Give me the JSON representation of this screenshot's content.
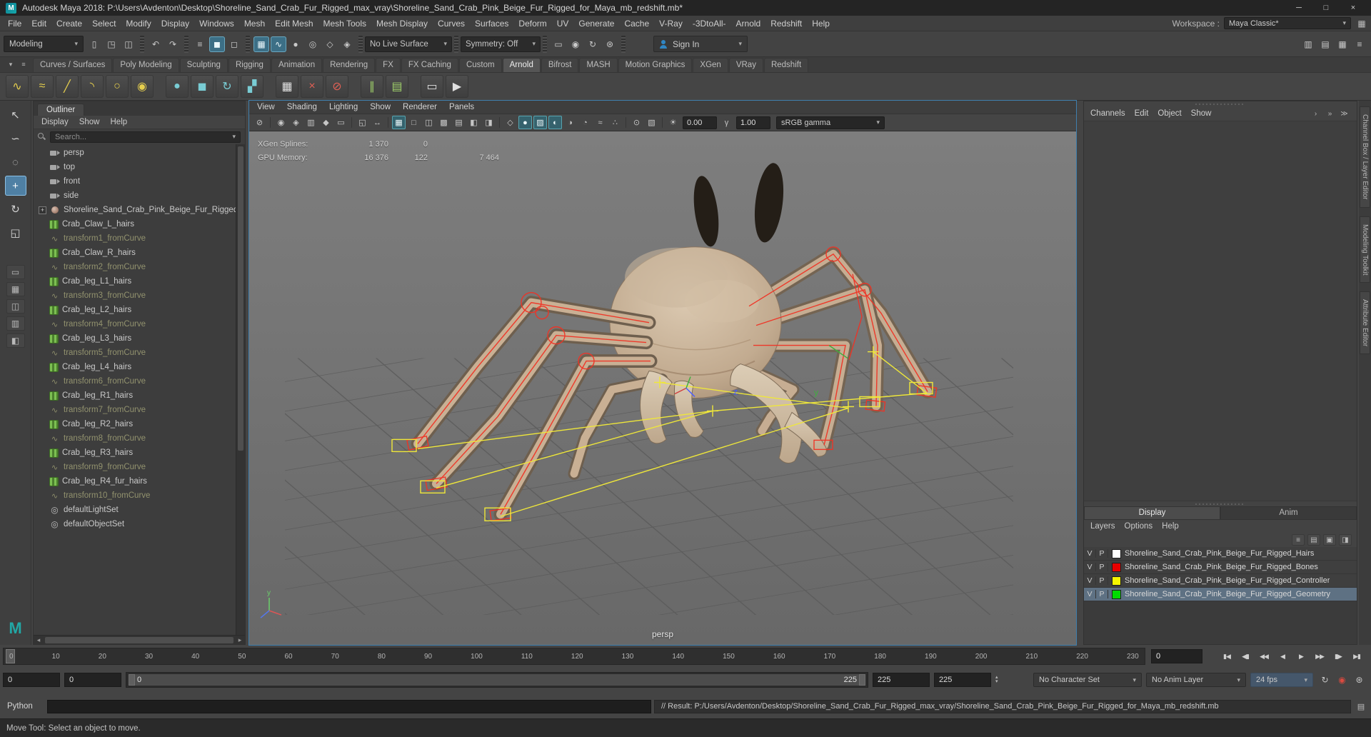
{
  "ui": {
    "caret": "▾",
    "caret_up": "▴",
    "caret_left": "◂",
    "caret_right": "▸",
    "plus": "+"
  },
  "titlebar": {
    "icon": "M",
    "title": "Autodesk Maya 2018: P:\\Users\\Avdenton\\Desktop\\Shoreline_Sand_Crab_Fur_Rigged_max_vray\\Shoreline_Sand_Crab_Pink_Beige_Fur_Rigged_for_Maya_mb_redshift.mb*",
    "buttons": [
      {
        "name": "minimize-button",
        "glyph": "─"
      },
      {
        "name": "maximize-button",
        "glyph": "□"
      },
      {
        "name": "close-button",
        "glyph": "×"
      }
    ]
  },
  "menubar": {
    "items": [
      "File",
      "Edit",
      "Create",
      "Select",
      "Modify",
      "Display",
      "Windows",
      "Mesh",
      "Edit Mesh",
      "Mesh Tools",
      "Mesh Display",
      "Curves",
      "Surfaces",
      "Deform",
      "UV",
      "Generate",
      "Cache",
      "V-Ray",
      "-3DtoAll-",
      "Arnold",
      "Redshift",
      "Help"
    ],
    "workspace_label": "Workspace :",
    "workspace_value": "Maya Classic*",
    "workspace_icon": "▦"
  },
  "statusline": {
    "mode": "Modeling",
    "icons_a": [
      {
        "name": "new-scene-icon",
        "glyph": "▯"
      },
      {
        "name": "open-scene-icon",
        "glyph": "◳"
      },
      {
        "name": "save-scene-icon",
        "glyph": "◫"
      },
      {
        "name": "separator",
        "glyph": "",
        "cls": "sep"
      },
      {
        "name": "undo-icon",
        "glyph": "↶"
      },
      {
        "name": "redo-icon",
        "glyph": "↷"
      },
      {
        "name": "separator",
        "glyph": "",
        "cls": "sep"
      },
      {
        "name": "select-hierarchy-icon",
        "glyph": "≡"
      },
      {
        "name": "select-object-icon",
        "glyph": "◼",
        "cls": "active"
      },
      {
        "name": "select-component-icon",
        "glyph": "◻"
      },
      {
        "name": "separator",
        "glyph": "",
        "cls": "sep"
      },
      {
        "name": "snap-grid-icon",
        "glyph": "▦",
        "cls": "active"
      },
      {
        "name": "snap-curve-icon",
        "glyph": "∿",
        "cls": "active"
      },
      {
        "name": "snap-point-icon",
        "glyph": "●"
      },
      {
        "name": "snap-projected-center-icon",
        "glyph": "◎"
      },
      {
        "name": "snap-view-plane-icon",
        "glyph": "◇"
      },
      {
        "name": "make-live-icon",
        "glyph": "◈"
      },
      {
        "name": "separator",
        "glyph": "",
        "cls": "sep"
      }
    ],
    "live_surface": "No Live Surface",
    "icons_b": [
      {
        "name": "separator",
        "glyph": "",
        "cls": "sep"
      }
    ],
    "symmetry": "Symmetry: Off",
    "icons_c": [
      {
        "name": "separator",
        "glyph": "",
        "cls": "sep"
      },
      {
        "name": "render-view-icon",
        "glyph": "▭"
      },
      {
        "name": "render-current-frame-icon",
        "glyph": "◉"
      },
      {
        "name": "ipr-render-icon",
        "glyph": "↻"
      },
      {
        "name": "render-settings-icon",
        "glyph": "⊛"
      },
      {
        "name": "separator",
        "glyph": "",
        "cls": "sep"
      }
    ],
    "sign_in": "Sign In",
    "icons_right": [
      {
        "name": "attribute-editor-toggle-icon",
        "glyph": "▥"
      },
      {
        "name": "tool-settings-toggle-icon",
        "glyph": "▤"
      },
      {
        "name": "channel-box-toggle-icon",
        "glyph": "▦"
      },
      {
        "name": "workspace-menu-icon",
        "glyph": "≡"
      }
    ]
  },
  "shelf": {
    "left_icons": [
      {
        "name": "shelf-tab-toggle-icon",
        "glyph": "▾"
      },
      {
        "name": "shelf-menu-icon",
        "glyph": "≡"
      }
    ],
    "tabs": [
      {
        "label": "Curves / Surfaces"
      },
      {
        "label": "Poly Modeling"
      },
      {
        "label": "Sculpting"
      },
      {
        "label": "Rigging"
      },
      {
        "label": "Animation"
      },
      {
        "label": "Rendering"
      },
      {
        "label": "FX"
      },
      {
        "label": "FX Caching"
      },
      {
        "label": "Custom"
      },
      {
        "label": "Arnold",
        "cls": "active"
      },
      {
        "label": "Bifrost"
      },
      {
        "label": "MASH"
      },
      {
        "label": "Motion Graphics"
      },
      {
        "label": "XGen"
      },
      {
        "label": "VRay"
      },
      {
        "label": "Redshift"
      }
    ],
    "icons": [
      {
        "name": "cv-curve-tool-icon",
        "glyph": "∿",
        "cls": "tint-y"
      },
      {
        "name": "ep-curve-tool-icon",
        "glyph": "≈",
        "cls": "tint-y"
      },
      {
        "name": "bezier-curve-tool-icon",
        "glyph": "╱",
        "cls": "tint-y"
      },
      {
        "name": "arc-tool-icon",
        "glyph": "◝",
        "cls": "tint-y"
      },
      {
        "name": "nurbs-circle-icon",
        "glyph": "○",
        "cls": "tint-y"
      },
      {
        "name": "nurbs-sphere-icon",
        "glyph": "◉",
        "cls": "tint-y"
      },
      {
        "name": "poly-sphere-icon",
        "glyph": "●",
        "cls": "tint-t gap"
      },
      {
        "name": "poly-cube-icon",
        "glyph": "◼",
        "cls": "tint-t"
      },
      {
        "name": "poly-helix-icon",
        "glyph": "↻",
        "cls": "tint-t"
      },
      {
        "name": "poly-stairs-icon",
        "glyph": "▞",
        "cls": "tint-t"
      },
      {
        "name": "xgen-create-description-icon",
        "glyph": "▦",
        "cls": "tint-w gap"
      },
      {
        "name": "xgen-delete-icon",
        "glyph": "×",
        "cls": "tint-r"
      },
      {
        "name": "xgen-clear-icon",
        "glyph": "⊘",
        "cls": "tint-r"
      },
      {
        "name": "xgen-description-editor-icon",
        "glyph": "∥",
        "cls": "tint-g gap"
      },
      {
        "name": "xgen-preview-icon",
        "glyph": "▤",
        "cls": "tint-g"
      },
      {
        "name": "render-view-shelf-icon",
        "glyph": "▭",
        "cls": "tint-w gap"
      },
      {
        "name": "playblast-icon",
        "glyph": "▶",
        "cls": "tint-w"
      }
    ]
  },
  "toolbox": {
    "tools": [
      {
        "name": "select-tool",
        "glyph": "↖"
      },
      {
        "name": "lasso-tool",
        "glyph": "∽"
      },
      {
        "name": "paint-select-tool",
        "glyph": "◌"
      },
      {
        "name": "move-tool",
        "glyph": "+",
        "cls": "active"
      },
      {
        "name": "rotate-tool",
        "glyph": "↻"
      },
      {
        "name": "scale-tool",
        "glyph": "◱"
      }
    ],
    "layouts": [
      {
        "name": "layout-single-button",
        "glyph": "▭"
      },
      {
        "name": "layout-four-pane-button",
        "glyph": "▦"
      },
      {
        "name": "layout-two-side-button",
        "glyph": "◫"
      },
      {
        "name": "layout-two-stack-button",
        "glyph": "▥"
      },
      {
        "name": "layout-outliner-persp-button",
        "glyph": "◧"
      }
    ],
    "logo": "M"
  },
  "outliner": {
    "tab": "Outliner",
    "menus": [
      "Display",
      "Show",
      "Help"
    ],
    "search_placeholder": "Search...",
    "items": [
      {
        "label": "persp",
        "type": "camera"
      },
      {
        "label": "top",
        "type": "camera"
      },
      {
        "label": "front",
        "type": "camera"
      },
      {
        "label": "side",
        "type": "camera"
      },
      {
        "label": "Shoreline_Sand_Crab_Pink_Beige_Fur_Rigged",
        "type": "root"
      },
      {
        "label": "Crab_Claw_L_hairs",
        "type": "xgen"
      },
      {
        "label": "transform1_fromCurve",
        "type": "curve"
      },
      {
        "label": "Crab_Claw_R_hairs",
        "type": "xgen"
      },
      {
        "label": "transform2_fromCurve",
        "type": "curve"
      },
      {
        "label": "Crab_leg_L1_hairs",
        "type": "xgen"
      },
      {
        "label": "transform3_fromCurve",
        "type": "curve"
      },
      {
        "label": "Crab_leg_L2_hairs",
        "type": "xgen"
      },
      {
        "label": "transform4_fromCurve",
        "type": "curve"
      },
      {
        "label": "Crab_leg_L3_hairs",
        "type": "xgen"
      },
      {
        "label": "transform5_fromCurve",
        "type": "curve"
      },
      {
        "label": "Crab_leg_L4_hairs",
        "type": "xgen"
      },
      {
        "label": "transform6_fromCurve",
        "type": "curve"
      },
      {
        "label": "Crab_leg_R1_hairs",
        "type": "xgen"
      },
      {
        "label": "transform7_fromCurve",
        "type": "curve"
      },
      {
        "label": "Crab_leg_R2_hairs",
        "type": "xgen"
      },
      {
        "label": "transform8_fromCurve",
        "type": "curve"
      },
      {
        "label": "Crab_leg_R3_hairs",
        "type": "xgen"
      },
      {
        "label": "transform9_fromCurve",
        "type": "curve"
      },
      {
        "label": "Crab_leg_R4_fur_hairs",
        "type": "xgen"
      },
      {
        "label": "transform10_fromCurve",
        "type": "curve"
      },
      {
        "label": "defaultLightSet",
        "type": "set"
      },
      {
        "label": "defaultObjectSet",
        "type": "set"
      }
    ]
  },
  "viewport": {
    "menus": [
      "View",
      "Shading",
      "Lighting",
      "Show",
      "Renderer",
      "Panels"
    ],
    "icons": [
      {
        "name": "selectability-icon",
        "glyph": "⊘"
      },
      {
        "name": "separator",
        "glyph": "",
        "cls": "vsep"
      },
      {
        "name": "select-camera-icon",
        "glyph": "◉"
      },
      {
        "name": "lock-camera-icon",
        "glyph": "◈"
      },
      {
        "name": "camera-attributes-icon",
        "glyph": "▥"
      },
      {
        "name": "bookmark-icon",
        "glyph": "◆"
      },
      {
        "name": "image-plane-icon",
        "glyph": "▭"
      },
      {
        "name": "separator",
        "glyph": "",
        "cls": "vsep"
      },
      {
        "name": "2d-pan-zoom-icon",
        "glyph": "◱"
      },
      {
        "name": "oneclick-pan-zoom-icon",
        "glyph": "↔"
      },
      {
        "name": "separator",
        "glyph": "",
        "cls": "vsep"
      },
      {
        "name": "grid-icon",
        "glyph": "▦",
        "cls": "active"
      },
      {
        "name": "film-gate-icon",
        "glyph": "□"
      },
      {
        "name": "resolution-gate-icon",
        "glyph": "◫"
      },
      {
        "name": "gate-mask-icon",
        "glyph": "▩"
      },
      {
        "name": "field-chart-icon",
        "glyph": "▤"
      },
      {
        "name": "safe-action-icon",
        "glyph": "◧"
      },
      {
        "name": "safe-title-icon",
        "glyph": "◨"
      },
      {
        "name": "separator",
        "glyph": "",
        "cls": "vsep"
      },
      {
        "name": "wireframe-icon",
        "glyph": "◇"
      },
      {
        "name": "smooth-shade-icon",
        "glyph": "●",
        "cls": "active"
      },
      {
        "name": "textured-icon",
        "glyph": "▨",
        "cls": "active"
      },
      {
        "name": "use-all-lights-icon",
        "glyph": "◐",
        "cls": "active"
      },
      {
        "name": "shadows-icon",
        "glyph": "◑"
      },
      {
        "name": "screen-space-ao-icon",
        "glyph": "◔"
      },
      {
        "name": "motion-blur-icon",
        "glyph": "≈"
      },
      {
        "name": "multisample-icon",
        "glyph": "∴"
      },
      {
        "name": "separator",
        "glyph": "",
        "cls": "vsep"
      },
      {
        "name": "isolate-select-icon",
        "glyph": "⊙"
      },
      {
        "name": "xray-icon",
        "glyph": "▧"
      },
      {
        "name": "separator",
        "glyph": "",
        "cls": "vsep"
      }
    ],
    "exposure_icon": "☀",
    "exposure": "0.00",
    "gamma_icon": "γ",
    "gamma": "1.00",
    "colorspace": "sRGB gamma",
    "hud": {
      "xgen_label": "XGen Splines:",
      "xgen_total": "1 370",
      "xgen_selected": "0",
      "gpu_label": "GPU Memory:",
      "gpu_total": "16 376",
      "gpu_used": "122",
      "gpu_free": "7 464"
    },
    "camera_label": "persp",
    "axis_z": "z",
    "axis_y": "y",
    "gizmo_y": "y"
  },
  "channel_box": {
    "menus": [
      "Channels",
      "Edit",
      "Object",
      "Show"
    ],
    "icons": [
      {
        "name": "manip-slow-icon",
        "glyph": "›"
      },
      {
        "name": "manip-medium-icon",
        "glyph": "»"
      },
      {
        "name": "manip-fast-icon",
        "glyph": "≫"
      }
    ]
  },
  "layer_editor": {
    "tabs": [
      {
        "label": "Display",
        "cls": "active"
      },
      {
        "label": "Anim"
      }
    ],
    "menus": [
      "Layers",
      "Options",
      "Help"
    ],
    "icons": [
      {
        "name": "layer-list-icon",
        "glyph": "≡"
      },
      {
        "name": "new-empty-layer-icon",
        "glyph": "▤"
      },
      {
        "name": "new-layer-from-selected-icon",
        "glyph": "▣"
      },
      {
        "name": "layer-options-icon",
        "glyph": "◨"
      }
    ],
    "layers": [
      {
        "v": "V",
        "p": "P",
        "color": "#ffffff",
        "name": "Shoreline_Sand_Crab_Pink_Beige_Fur_Rigged_Hairs"
      },
      {
        "v": "V",
        "p": "P",
        "color": "#e80000",
        "name": "Shoreline_Sand_Crab_Pink_Beige_Fur_Rigged_Bones"
      },
      {
        "v": "V",
        "p": "P",
        "color": "#f5f500",
        "name": "Shoreline_Sand_Crab_Pink_Beige_Fur_Rigged_Controller"
      },
      {
        "v": "V",
        "p": "P",
        "color": "#00dc00",
        "name": "Shoreline_Sand_Crab_Pink_Beige_Fur_Rigged_Geometry",
        "cls": "selected"
      }
    ]
  },
  "side_tabs": [
    "Channel Box / Layer Editor",
    "Modeling Toolkit",
    "Attribute Editor"
  ],
  "timeline": {
    "ticks": [
      "0",
      "10",
      "20",
      "30",
      "40",
      "50",
      "60",
      "70",
      "80",
      "90",
      "100",
      "110",
      "120",
      "130",
      "140",
      "150",
      "160",
      "170",
      "180",
      "190",
      "200",
      "210",
      "220",
      "230"
    ],
    "current_frame": "0",
    "buttons": [
      {
        "name": "go-to-start-button",
        "glyph": "▮◀"
      },
      {
        "name": "step-back-frame-button",
        "glyph": "◀▮"
      },
      {
        "name": "step-back-key-button",
        "glyph": "◀◀"
      },
      {
        "name": "play-backwards-button",
        "glyph": "◀"
      },
      {
        "name": "play-forwards-button",
        "glyph": "▶"
      },
      {
        "name": "step-forward-key-button",
        "glyph": "▶▶"
      },
      {
        "name": "step-forward-frame-button",
        "glyph": "▮▶"
      },
      {
        "name": "go-to-end-button",
        "glyph": "▶▮"
      }
    ]
  },
  "range": {
    "anim_start": "0",
    "playback_start": "0",
    "range_start_label": "0",
    "range_end_label": "225",
    "playback_end": "225",
    "anim_end": "225",
    "character_set": "No Character Set",
    "anim_layer": "No Anim Layer",
    "fps": "24 fps",
    "icons": [
      {
        "name": "playback-loop-icon",
        "glyph": "↻"
      },
      {
        "name": "auto-keyframe-icon",
        "glyph": "◉",
        "cls": "red"
      },
      {
        "name": "animation-preferences-icon",
        "glyph": "⊛"
      }
    ]
  },
  "command_line": {
    "label": "Python",
    "result": "// Result: P:/Users/Avdenton/Desktop/Shoreline_Sand_Crab_Fur_Rigged_max_vray/Shoreline_Sand_Crab_Pink_Beige_Fur_Rigged_for_Maya_mb_redshift.mb",
    "icon": "▤"
  },
  "help_line": "Move Tool: Select an object to move."
}
